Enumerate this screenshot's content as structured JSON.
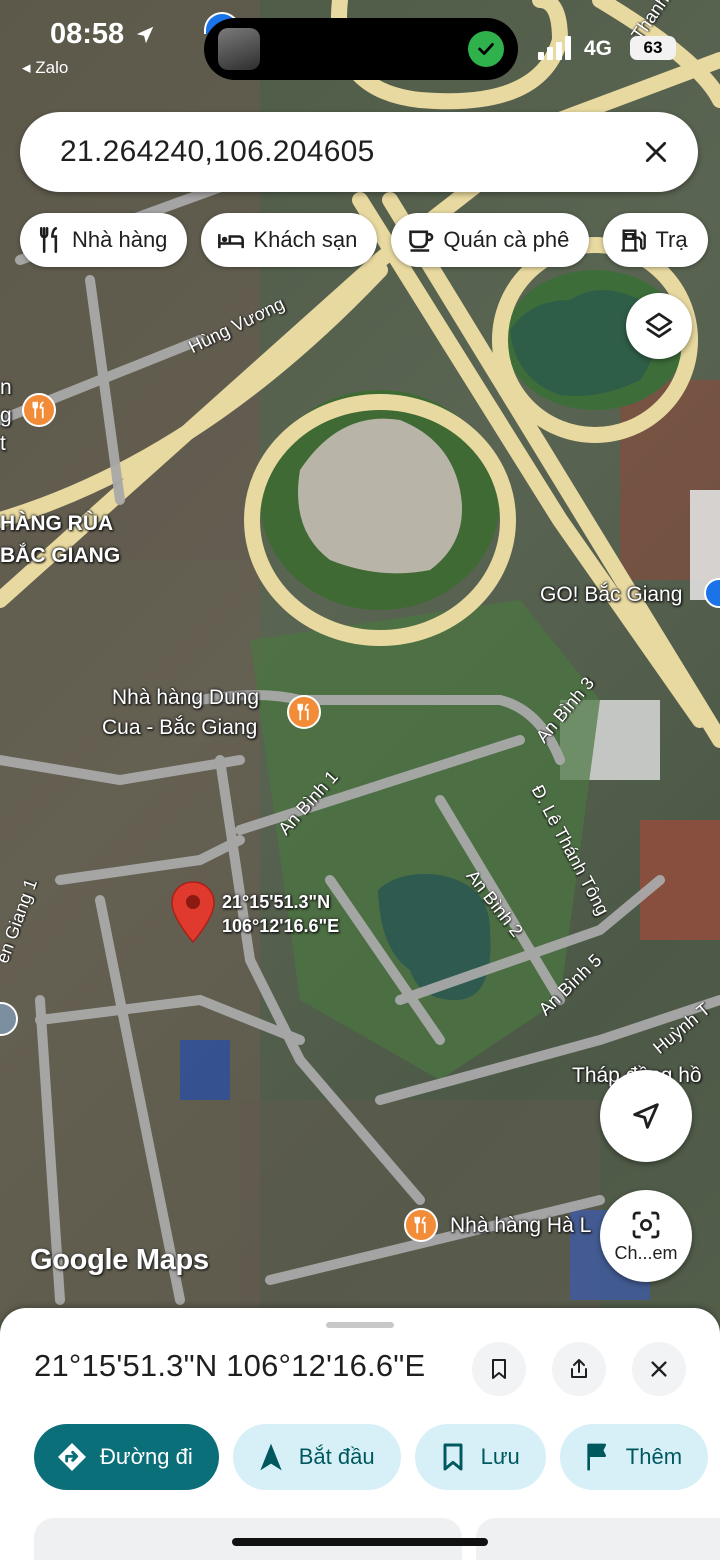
{
  "status_bar": {
    "time": "08:58",
    "back_app": "◂ Zalo",
    "network": "4G",
    "battery": "63"
  },
  "search": {
    "query": "21.264240,106.204605"
  },
  "chips": [
    {
      "label": "Nhà hàng",
      "icon": "fork-knife-icon"
    },
    {
      "label": "Khách sạn",
      "icon": "bed-icon"
    },
    {
      "label": "Quán cà phê",
      "icon": "coffee-cup-icon"
    },
    {
      "label": "Trạ",
      "icon": "gas-station-icon"
    }
  ],
  "map": {
    "labels": {
      "hung_vuong": "Hùng Vương",
      "hang_rua": "HÀNG RÙA",
      "bac_giang": "BẮC GIANG",
      "go_bac_giang": "GO! Bắc Giang",
      "restaurant_dung_1": "Nhà hàng Dung",
      "restaurant_dung_2": "Cua - Bắc Giang",
      "an_binh_1": "An Bình 1",
      "an_binh_2": "An Bình 2",
      "an_binh_3": "An Bình 3",
      "an_binh_5": "An Bình 5",
      "le_thanh_tong": "Đ. Lê Thánh Tông",
      "huynh_t": "Huỳnh T",
      "thap_dong_ho": "Tháp đồng hồ",
      "nha_hang_ha": "Nhà hàng Hà L",
      "giang_1": "en Giang 1",
      "thanh": "Thanh",
      "left_n": "n",
      "left_g": "g",
      "left_t": "t"
    },
    "pin_lat": "21°15'51.3\"N",
    "pin_lng": "106°12'16.6\"E",
    "watermark": "Google Maps",
    "lens_label": "Ch...em"
  },
  "sheet": {
    "title": "21°15'51.3\"N 106°12'16.6\"E",
    "actions": [
      {
        "label": "Đường đi",
        "icon": "directions-icon"
      },
      {
        "label": "Bắt đầu",
        "icon": "navigation-arrow-icon"
      },
      {
        "label": "Lưu",
        "icon": "bookmark-icon"
      },
      {
        "label": "Thêm",
        "icon": "flag-icon"
      }
    ]
  },
  "colors": {
    "accent": "#0b6f7a",
    "action_bg": "#d7f0f8",
    "poi_orange": "#f28c38",
    "pin_red": "#e03a2f",
    "road_yellow": "#e8d9a0"
  }
}
